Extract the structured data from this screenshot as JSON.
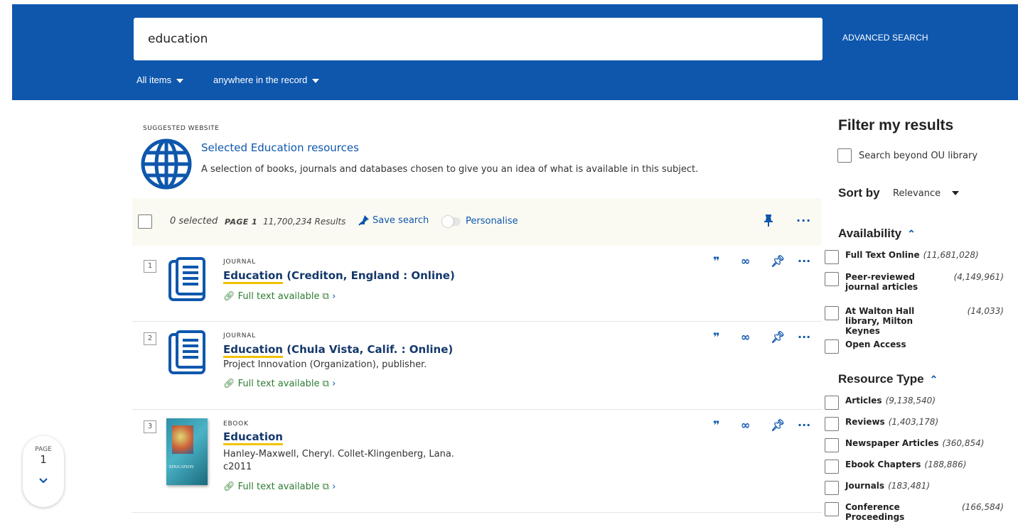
{
  "search": {
    "query": "education",
    "advanced_label": "ADVANCED SEARCH",
    "scope": "All items",
    "field": "anywhere in the record"
  },
  "suggested": {
    "label": "SUGGESTED WEBSITE",
    "title": "Selected Education resources",
    "description": "A selection of books, journals and databases chosen to give you an idea of what is available in this subject."
  },
  "toolbar": {
    "selected": "0 selected",
    "page": "PAGE 1",
    "results": "11,700,234 Results",
    "save_search": "Save search",
    "personalise": "Personalise"
  },
  "results": [
    {
      "num": "1",
      "type": "JOURNAL",
      "title_hl": "Education",
      "title_rest": " (Crediton, England : Online)",
      "full_text": "Full text available"
    },
    {
      "num": "2",
      "type": "JOURNAL",
      "title_hl": "Education",
      "title_rest": " (Chula Vista, Calif. : Online)",
      "sub1": "Project Innovation (Organization), publisher.",
      "full_text": "Full text available"
    },
    {
      "num": "3",
      "type": "EBOOK",
      "title_hl": "Education",
      "title_rest": "",
      "sub1": "Hanley-Maxwell, Cheryl. Collet-Klingenberg, Lana.",
      "sub2": "c2011",
      "cover_text": "EDUCATION",
      "full_text": "Full text available"
    }
  ],
  "page_indicator": {
    "label": "PAGE",
    "number": "1"
  },
  "filters": {
    "title": "Filter my results",
    "beyond": "Search beyond OU library",
    "sort_label": "Sort by",
    "sort_value": "Relevance",
    "availability": {
      "title": "Availability",
      "items": [
        {
          "label": "Full Text Online",
          "count": "(11,681,028)"
        },
        {
          "label": "Peer-reviewed journal articles",
          "count": "(4,149,961)"
        },
        {
          "label": "At Walton Hall library, Milton Keynes",
          "count": "(14,033)"
        },
        {
          "label": "Open Access",
          "count": ""
        }
      ]
    },
    "resource_type": {
      "title": "Resource Type",
      "items": [
        {
          "label": "Articles",
          "count": "(9,138,540)"
        },
        {
          "label": "Reviews",
          "count": "(1,403,178)"
        },
        {
          "label": "Newspaper Articles",
          "count": "(360,854)"
        },
        {
          "label": "Ebook Chapters",
          "count": "(188,886)"
        },
        {
          "label": "Journals",
          "count": "(183,481)"
        },
        {
          "label": "Conference Proceedings",
          "count": "(166,584)"
        }
      ]
    }
  },
  "colors": {
    "brand_blue": "#0e57ad",
    "title_navy": "#14386b",
    "fulltext_green": "#2e7d32",
    "highlight": "#f2c200"
  }
}
